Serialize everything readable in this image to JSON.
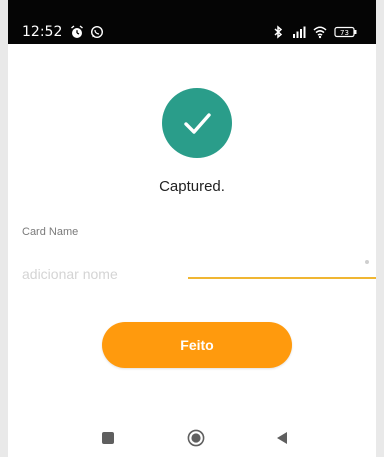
{
  "status_bar": {
    "time": "12:52",
    "left_icons": [
      "alarm-icon",
      "whatsapp-icon"
    ],
    "right_icons": [
      "bluetooth-icon",
      "signal-icon",
      "wifi-icon",
      "battery-icon"
    ],
    "battery_level": "73"
  },
  "confirmation": {
    "icon": "check-icon",
    "message": "Captured.",
    "accent_color": "#2a9d8a"
  },
  "card_name": {
    "label": "Card Name",
    "placeholder": "adicionar nome",
    "value": ""
  },
  "done_button": {
    "label": "Feito",
    "color": "#ff9a0d"
  },
  "navigation": {
    "buttons": [
      "recents-square-icon",
      "home-circle-icon",
      "back-triangle-icon"
    ]
  }
}
